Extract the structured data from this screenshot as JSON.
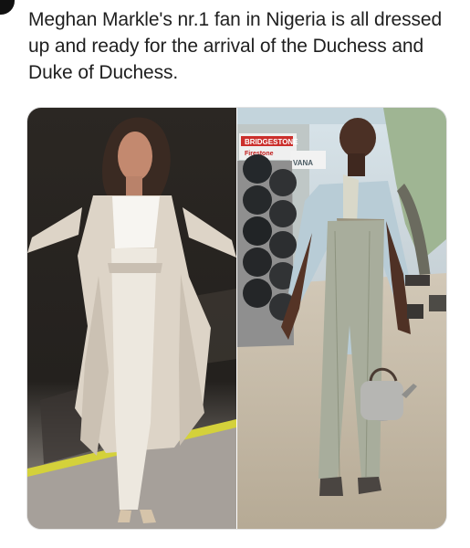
{
  "tweet": {
    "text": "Meghan Markle's nr.1 fan in Nigeria is all dressed up and ready for the arrival of the Duchess and Duke of Duchess."
  },
  "media": {
    "left_photo": {
      "kind": "photo"
    },
    "right_photo": {
      "kind": "photo",
      "storefront_signs": [
        "BRIDGESTONE",
        "Firestone",
        "VANA"
      ]
    }
  },
  "colors": {
    "text": "#1f1f1f",
    "background": "#ffffff",
    "left_coat": "#ddd4c7",
    "right_shirt": "#b8ccd6",
    "right_trousers": "#a8ad9c"
  }
}
